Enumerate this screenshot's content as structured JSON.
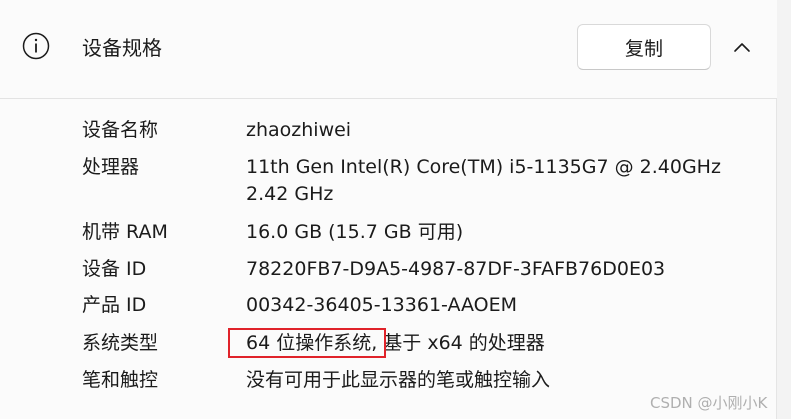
{
  "header": {
    "title": "设备规格",
    "copy_label": "复制"
  },
  "specs": [
    {
      "label": "设备名称",
      "value": "zhaozhiwei"
    },
    {
      "label": "处理器",
      "value": "11th Gen Intel(R) Core(TM) i5-1135G7 @ 2.40GHz",
      "value2": "2.42 GHz"
    },
    {
      "label": "机带 RAM",
      "value": "16.0 GB (15.7 GB 可用)"
    },
    {
      "label": "设备 ID",
      "value": "78220FB7-D9A5-4987-87DF-3FAFB76D0E03"
    },
    {
      "label": "产品 ID",
      "value": "00342-36405-13361-AAOEM"
    },
    {
      "label": "系统类型",
      "value": "64 位操作系统, 基于 x64 的处理器"
    },
    {
      "label": "笔和触控",
      "value": "没有可用于此显示器的笔或触控输入"
    }
  ],
  "watermark": "CSDN @小刚小K",
  "colors": {
    "highlight_border": "#e0232a"
  },
  "icons": {
    "info": "info-icon",
    "collapse": "chevron-up-icon"
  }
}
